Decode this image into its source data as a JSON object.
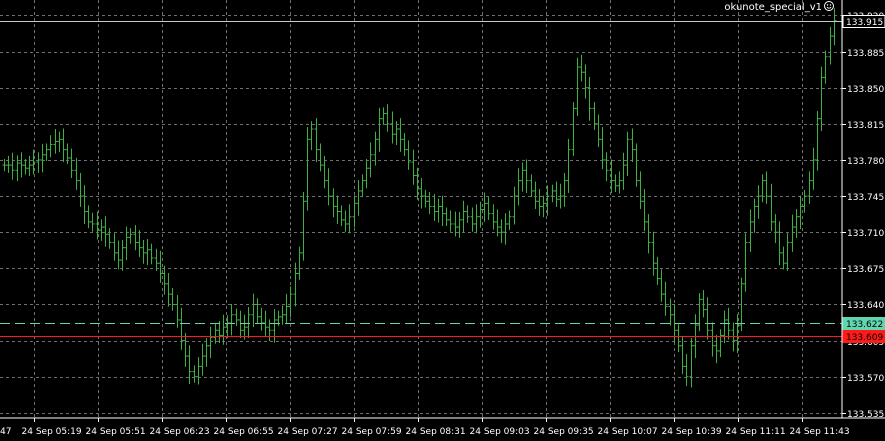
{
  "indicator_label": "okunote_special_v1",
  "indicator_icon": "smiley-icon",
  "colors": {
    "background": "#000000",
    "grid": "#6e6e6e",
    "axis": "#ffffff",
    "price_line": "#c8c8c8",
    "bar": "#3cb043",
    "bid_line": "#5fd5b0",
    "ask_line": "#ff1a1a"
  },
  "chart_data": {
    "type": "bar",
    "subtype": "ohlc-price-chart",
    "y_ticks": [
      "133.920",
      "133.885",
      "133.850",
      "133.815",
      "133.780",
      "133.745",
      "133.710",
      "133.675",
      "133.640",
      "133.605",
      "133.570",
      "133.535"
    ],
    "x_ticks": [
      "24 Sep 05:19",
      "24 Sep 05:51",
      "24 Sep 06:23",
      "24 Sep 06:55",
      "24 Sep 07:27",
      "24 Sep 07:59",
      "24 Sep 08:31",
      "24 Sep 09:03",
      "24 Sep 09:35",
      "24 Sep 10:07",
      "24 Sep 10:39",
      "24 Sep 11:11",
      "24 Sep 11:43"
    ],
    "x_partial_left_label": "47",
    "ylim": [
      133.53,
      133.935
    ],
    "grid": true,
    "price_labels": [
      {
        "value": 133.915,
        "label": "133.915",
        "style": "current"
      },
      {
        "value": 133.622,
        "label": "133.622",
        "style": "bid"
      },
      {
        "value": 133.609,
        "label": "133.609",
        "style": "ask"
      }
    ],
    "series": [
      {
        "values": [
          133.775,
          133.775,
          133.77,
          133.777,
          133.775,
          133.772,
          133.775,
          133.778,
          133.78,
          133.785,
          133.79,
          133.795,
          133.798,
          133.8,
          133.79,
          133.782,
          133.77,
          133.76,
          133.745,
          133.73,
          133.72,
          133.718,
          133.712,
          133.715,
          133.708,
          133.7,
          133.69,
          133.683,
          133.695,
          133.705,
          133.708,
          133.7,
          133.695,
          133.69,
          133.693,
          133.685,
          133.68,
          133.67,
          133.66,
          133.65,
          133.64,
          133.625,
          133.605,
          133.59,
          133.575,
          133.57,
          133.58,
          133.59,
          133.6,
          133.608,
          133.615,
          133.61,
          133.618,
          133.622,
          133.63,
          133.625,
          133.615,
          133.618,
          133.63,
          133.64,
          133.628,
          133.622,
          133.618,
          133.615,
          133.625,
          133.628,
          133.63,
          133.638,
          133.65,
          133.67,
          133.69,
          133.74,
          133.8,
          133.81,
          133.79,
          133.775,
          133.76,
          133.745,
          133.735,
          133.73,
          133.722,
          133.718,
          133.725,
          133.738,
          133.75,
          133.76,
          133.772,
          133.785,
          133.8,
          133.82,
          133.825,
          133.815,
          133.805,
          133.81,
          133.8,
          133.79,
          133.778,
          133.765,
          133.752,
          133.745,
          133.74,
          133.735,
          133.73,
          133.735,
          133.728,
          133.722,
          133.718,
          133.715,
          133.722,
          133.73,
          133.725,
          133.718,
          133.725,
          133.732,
          133.738,
          133.728,
          133.72,
          133.715,
          133.71,
          133.718,
          133.725,
          133.745,
          133.76,
          133.77,
          133.76,
          133.75,
          133.74,
          133.735,
          133.738,
          133.745,
          133.75,
          133.742,
          133.745,
          133.76,
          133.79,
          133.83,
          133.87,
          133.865,
          133.85,
          133.83,
          133.815,
          133.8,
          133.78,
          133.77,
          133.76,
          133.755,
          133.76,
          133.775,
          133.8,
          133.79,
          133.76,
          133.74,
          133.72,
          133.7,
          133.68,
          133.665,
          133.65,
          133.638,
          133.63,
          133.615,
          133.6,
          133.58,
          133.57,
          133.6,
          133.62,
          133.645,
          133.635,
          133.615,
          133.6,
          133.595,
          133.61,
          133.625,
          133.615,
          133.605,
          133.62,
          133.66,
          133.7,
          133.72,
          133.735,
          133.745,
          133.76,
          133.745,
          133.72,
          133.71,
          133.69,
          133.68,
          133.7,
          133.715,
          133.725,
          133.735,
          133.745,
          133.76,
          133.78,
          133.82,
          133.86,
          133.88,
          133.9,
          133.915
        ]
      }
    ]
  }
}
